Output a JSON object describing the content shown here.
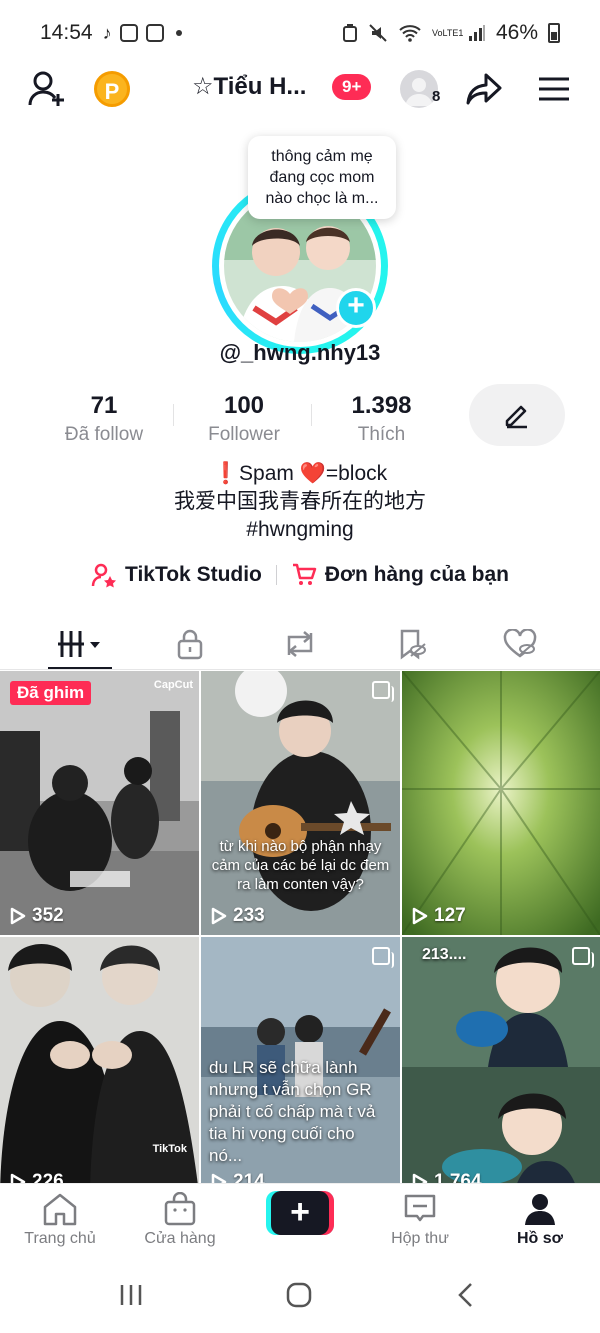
{
  "status_bar": {
    "time": "14:54",
    "battery": "46%",
    "network": "VoLTE1"
  },
  "header": {
    "coin_label": "P",
    "title": "☆Tiểu H...",
    "notification_badge": "9+",
    "friend_count": "8"
  },
  "profile": {
    "bubble_text": "thông cảm mẹ đang cọc mom nào chọc là m...",
    "handle": "@_hwng.nhy13",
    "stats": [
      {
        "value": "71",
        "label": "Đã follow"
      },
      {
        "value": "100",
        "label": "Follower"
      },
      {
        "value": "1.398",
        "label": "Thích"
      }
    ],
    "bio_lines": [
      "❗Spam ❤️=block",
      "我爱中国我青春所在的地方",
      "#hwngming"
    ],
    "links": [
      {
        "label": "TikTok Studio",
        "icon": "person-star-icon"
      },
      {
        "label": "Đơn hàng của bạn",
        "icon": "cart-icon"
      }
    ]
  },
  "tabs": [
    {
      "name": "videos-grid",
      "active": true
    },
    {
      "name": "private",
      "active": false
    },
    {
      "name": "reposts",
      "active": false
    },
    {
      "name": "favorites",
      "active": false
    },
    {
      "name": "liked",
      "active": false
    }
  ],
  "videos": [
    {
      "views": "352",
      "pinned_label": "Đã ghim",
      "overlay": "CapCut",
      "caption": ""
    },
    {
      "views": "233",
      "caption": "từ khi nào bộ phận nhạy cảm của các bé lại dc đem ra làm conten vậy?"
    },
    {
      "views": "127",
      "caption": ""
    },
    {
      "views": "226",
      "caption": "",
      "overlay": "TikTok"
    },
    {
      "views": "214",
      "caption": "du LR sẽ chữa lành nhưng t vẫn chọn GR phải t cố chấp mà t vả tia hi vọng cuối cho nó..."
    },
    {
      "views": "1.764",
      "caption": "213...."
    }
  ],
  "bottom_nav": [
    {
      "label": "Trang chủ",
      "icon": "home-icon"
    },
    {
      "label": "Cửa hàng",
      "icon": "shop-icon"
    },
    {
      "label": "",
      "icon": "plus-icon"
    },
    {
      "label": "Hộp thư",
      "icon": "inbox-icon"
    },
    {
      "label": "Hồ sơ",
      "icon": "profile-icon"
    }
  ],
  "colors": {
    "accent_red": "#fe2c55",
    "accent_cyan": "#25f4ee",
    "text": "#161823",
    "muted": "#8a8b91"
  }
}
